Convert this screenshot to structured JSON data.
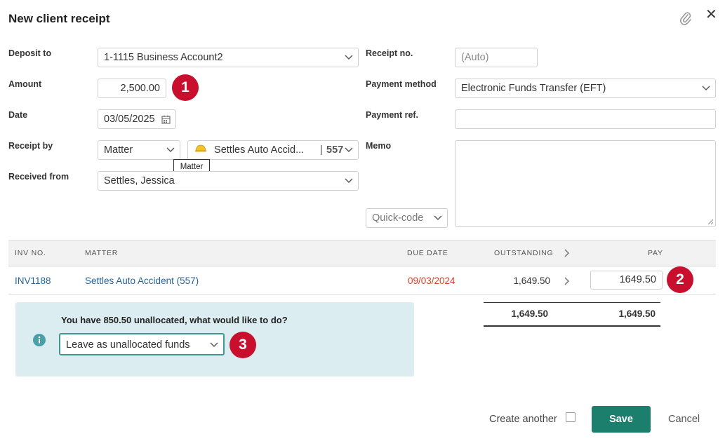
{
  "dialog": {
    "title": "New client receipt"
  },
  "form": {
    "deposit_to": {
      "label": "Deposit to",
      "value": "1-1115 Business Account2"
    },
    "amount": {
      "label": "Amount",
      "value": "2,500.00"
    },
    "date": {
      "label": "Date",
      "value": "03/05/2025"
    },
    "receipt_by": {
      "label": "Receipt by",
      "type_value": "Matter",
      "matter_value": "Settles Auto Accid...",
      "matter_number": "557",
      "tooltip": "Matter"
    },
    "received_from": {
      "label": "Received from",
      "value": "Settles, Jessica"
    },
    "receipt_no": {
      "label": "Receipt no.",
      "placeholder": "(Auto)"
    },
    "payment_method": {
      "label": "Payment method",
      "value": "Electronic Funds Transfer (EFT)"
    },
    "payment_ref": {
      "label": "Payment ref.",
      "value": ""
    },
    "memo": {
      "label": "Memo",
      "value": ""
    },
    "quick_code": {
      "value": "Quick-code"
    }
  },
  "table": {
    "headers": {
      "inv_no": "INV NO.",
      "matter": "MATTER",
      "due_date": "DUE DATE",
      "outstanding": "OUTSTANDING",
      "pay": "PAY"
    },
    "rows": [
      {
        "inv_no": "INV1188",
        "matter": "Settles Auto Accident (557)",
        "due_date": "09/03/2024",
        "outstanding": "1,649.50",
        "pay": "1649.50"
      }
    ],
    "totals": {
      "outstanding": "1,649.50",
      "pay": "1,649.50"
    }
  },
  "alert": {
    "message": "You have 850.50 unallocated, what would like to do?",
    "select_value": "Leave as unallocated funds"
  },
  "annotations": {
    "badge1": "1",
    "badge2": "2",
    "badge3": "3"
  },
  "footer": {
    "create_another": "Create another",
    "save": "Save",
    "cancel": "Cancel"
  },
  "colors": {
    "accent": "#1c7f6e",
    "badge": "#c8102e",
    "link": "#27659a",
    "overdue": "#d9402b",
    "alert_bg": "#dcedf1"
  }
}
